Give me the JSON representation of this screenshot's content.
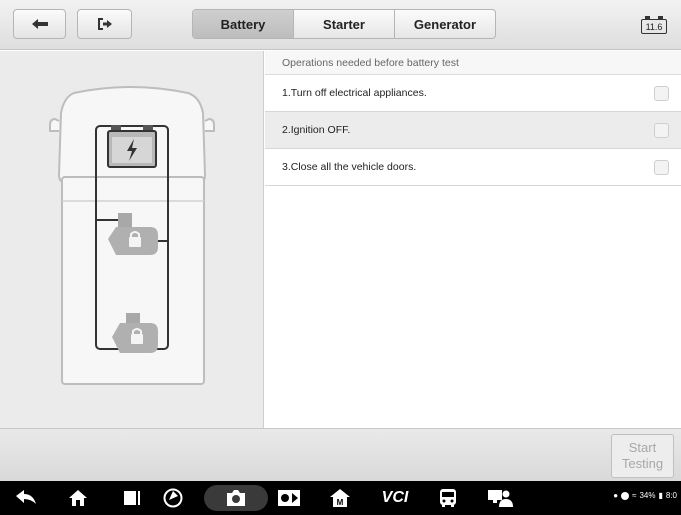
{
  "header": {
    "back_icon": "arrow-left-icon",
    "exit_icon": "exit-icon",
    "tabs": [
      {
        "label": "Battery",
        "active": true
      },
      {
        "label": "Starter",
        "active": false
      },
      {
        "label": "Generator",
        "active": false
      }
    ],
    "voltage": "11.6"
  },
  "operations": {
    "title": "Operations needed before battery test",
    "items": [
      {
        "label": "1.Turn off electrical appliances.",
        "checked": false,
        "selected": false
      },
      {
        "label": "2.Ignition OFF.",
        "checked": false,
        "selected": true
      },
      {
        "label": "3.Close all the vehicle doors.",
        "checked": false,
        "selected": false
      }
    ]
  },
  "footer": {
    "start_line1": "Start",
    "start_line2": "Testing"
  },
  "system_bar": {
    "status": "34%",
    "time": "8:0"
  },
  "colors": {
    "active_tab": "#c4c4c4",
    "selected_row": "#ececec",
    "disabled_text": "#a8a8a8"
  }
}
